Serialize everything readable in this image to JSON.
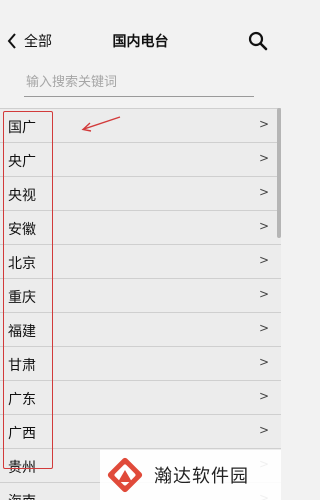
{
  "header": {
    "back_label": "全部",
    "title": "国内电台"
  },
  "search": {
    "placeholder": "输入搜索关键词"
  },
  "list": {
    "items": [
      {
        "label": "国广",
        "arrow": ">"
      },
      {
        "label": "央广",
        "arrow": ">"
      },
      {
        "label": "央视",
        "arrow": ">"
      },
      {
        "label": "安徽",
        "arrow": ">"
      },
      {
        "label": "北京",
        "arrow": ">"
      },
      {
        "label": "重庆",
        "arrow": ">"
      },
      {
        "label": "福建",
        "arrow": ">"
      },
      {
        "label": "甘肃",
        "arrow": ">"
      },
      {
        "label": "广东",
        "arrow": ">"
      },
      {
        "label": "广西",
        "arrow": ">"
      },
      {
        "label": "贵州",
        "arrow": ">"
      },
      {
        "label": "海南",
        "arrow": ">"
      }
    ]
  },
  "watermark": {
    "text": "瀚达软件园"
  },
  "colors": {
    "background": "#f2f2f2",
    "list_item": "#ececec",
    "annotation": "#d23a3a"
  },
  "icons": {
    "back": "chevron-left-icon",
    "search": "magnifier-icon",
    "arrow": "chevron-right"
  }
}
